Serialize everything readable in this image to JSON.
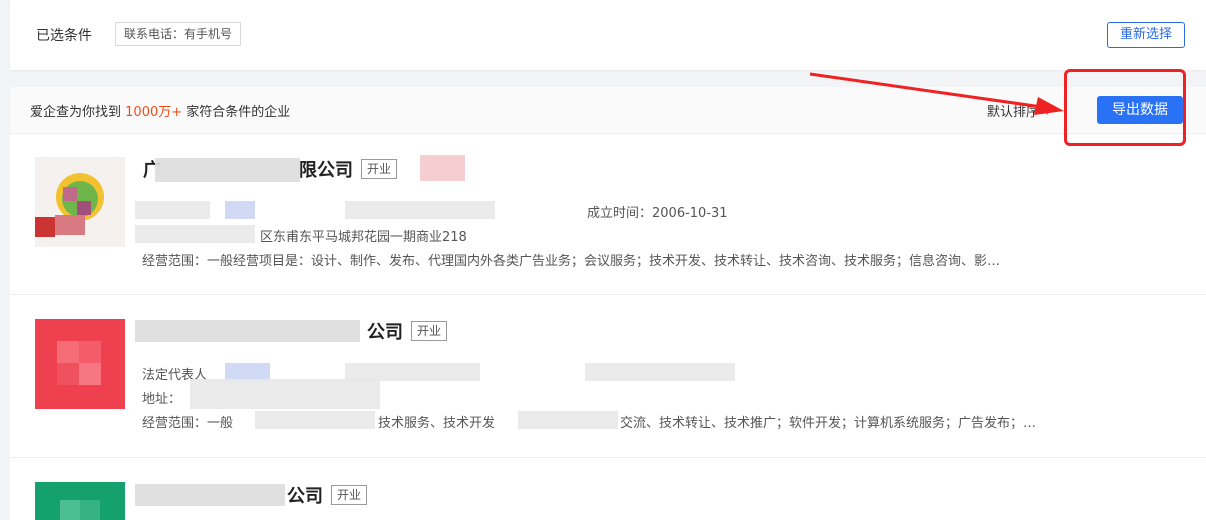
{
  "filter_bar": {
    "label": "已选条件",
    "tag": "联系电话：有手机号",
    "reselect": "重新选择"
  },
  "results": {
    "summary_prefix": "爱企查为你找到",
    "summary_count": "1000万+",
    "summary_suffix": "家符合条件的企业",
    "sort_label": "默认排序",
    "export_label": "导出数据"
  },
  "companies": [
    {
      "name_start": "广",
      "name_end": "限公司",
      "status": "开业",
      "founded": "成立时间：2006-10-31",
      "address_tail": "区东甫东平马城邦花园一期商业218",
      "scope": "经营范围：一般经营项目是：设计、制作、发布、代理国内外各类广告业务；会议服务；技术开发、技术转让、技术咨询、技术服务；信息咨询、影…"
    },
    {
      "name_end": "公司",
      "status": "开业",
      "legal_rep": "法定代表人",
      "address": "地址：",
      "scope_start": "经营范围：一般",
      "scope_mid": "技术服务、技术开发",
      "scope_end": "交流、技术转让、技术推广；软件开发；计算机系统服务；广告发布；…"
    },
    {
      "name_end": "公司",
      "status": "开业"
    }
  ],
  "colors": {
    "accent_blue": "#2a72f5",
    "count_orange": "#f04d1c",
    "annotation_red": "#e22"
  }
}
